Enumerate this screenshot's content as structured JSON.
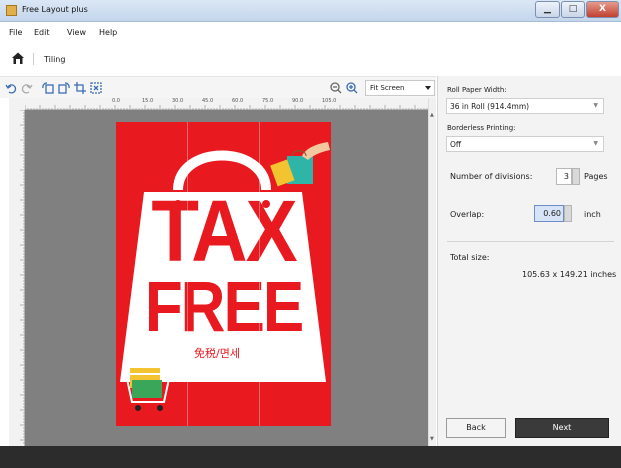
{
  "window": {
    "title": "Free Layout plus",
    "controls": {
      "minimize": "▁",
      "maximize": "□",
      "close": "X"
    }
  },
  "menu": [
    "File",
    "Edit",
    "View",
    "Help"
  ],
  "mode": {
    "label": "Tiling"
  },
  "toolbar": {
    "zoom_value": "Fit Screen"
  },
  "ruler": {
    "top_ticks": [
      "0.0",
      "15.0",
      "30.0",
      "45.0",
      "60.0",
      "75.0",
      "90.0",
      "105.0"
    ]
  },
  "poster": {
    "line1": "TAX",
    "line2": "FREE",
    "sub": "免税/면세"
  },
  "panel": {
    "roll_label": "Roll Paper Width:",
    "roll_value": "36 in Roll (914.4mm)",
    "borderless_label": "Borderless Printing:",
    "borderless_value": "Off",
    "divisions_label": "Number of divisions:",
    "divisions_value": "3",
    "divisions_unit": "Pages",
    "overlap_label": "Overlap:",
    "overlap_value": "0.60",
    "overlap_unit": "inch",
    "total_label": "Total size:",
    "total_value": "105.63 x 149.21 inches",
    "back_label": "Back",
    "next_label": "Next"
  },
  "colors": {
    "poster_red": "#e8191f",
    "canvas_gray": "#808080",
    "accent_blue": "#3c6cb4"
  }
}
